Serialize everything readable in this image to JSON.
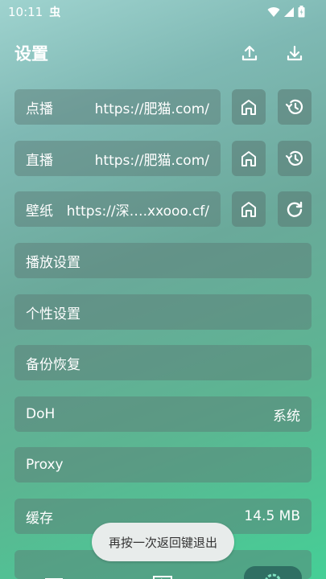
{
  "status": {
    "time": "10:11",
    "notif_glyph": "虫",
    "icons": [
      "wifi-icon",
      "signal-icon",
      "battery-icon"
    ]
  },
  "header": {
    "title": "设置",
    "icons": [
      "upload-icon",
      "download-icon"
    ]
  },
  "sources": [
    {
      "label": "点播",
      "value": "https://肥猫.com/",
      "icons": [
        "home-icon",
        "history-icon"
      ]
    },
    {
      "label": "直播",
      "value": "https://肥猫.com/",
      "icons": [
        "home-icon",
        "history-icon"
      ]
    },
    {
      "label": "壁纸",
      "value": "https://深….xxooo.cf/",
      "icons": [
        "home-icon",
        "refresh-icon"
      ]
    }
  ],
  "settings": [
    {
      "label": "播放设置",
      "value": ""
    },
    {
      "label": "个性设置",
      "value": ""
    },
    {
      "label": "备份恢复",
      "value": ""
    },
    {
      "label": "DoH",
      "value": "系统"
    },
    {
      "label": "Proxy",
      "value": ""
    },
    {
      "label": "缓存",
      "value": "14.5 MB"
    }
  ],
  "toast": {
    "text": "再按一次返回键退出"
  },
  "bottom_nav": {
    "items": [
      "film-icon",
      "live-tv-icon",
      "settings-icon"
    ],
    "active": "settings-icon"
  }
}
